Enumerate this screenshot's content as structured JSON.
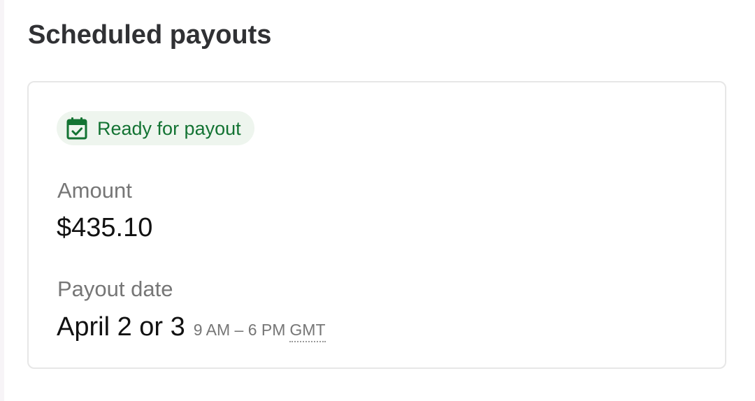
{
  "section": {
    "title": "Scheduled payouts"
  },
  "payout": {
    "status_label": "Ready for payout",
    "status_icon": "calendar-check-icon",
    "status_color": "#137333",
    "amount_label": "Amount",
    "amount": "$435.10",
    "date_label": "Payout date",
    "date": "April 2 or 3",
    "time_range": "9 AM – 6 PM",
    "timezone": "GMT"
  }
}
